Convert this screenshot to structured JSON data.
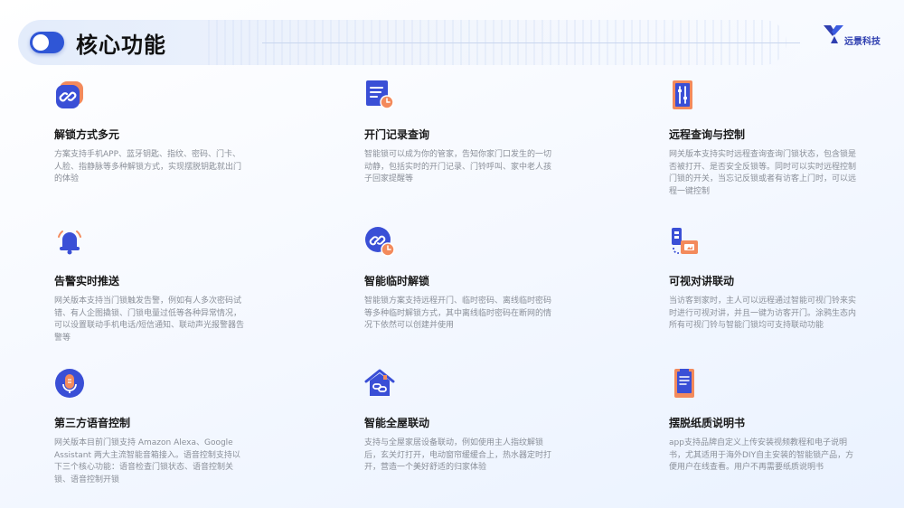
{
  "header": {
    "title": "核心功能",
    "logo_text": "远景科技"
  },
  "colors": {
    "accent": "#2f56d6",
    "icon_orange": "#f38a5c",
    "icon_blue": "#3a4fd6"
  },
  "features": [
    {
      "icon": "link-icon",
      "title": "解锁方式多元",
      "desc": "方案支持手机APP、蓝牙钥匙、指纹、密码、门卡、人脸、指静脉等多种解锁方式，实现摆脱钥匙就出门的体验"
    },
    {
      "icon": "document-clock-icon",
      "title": "开门记录查询",
      "desc": "智能锁可以成为你的管家，告知你家门口发生的一切动静，包括实时的开门记录、门铃呼叫、家中老人孩子回家提醒等"
    },
    {
      "icon": "sliders-icon",
      "title": "远程查询与控制",
      "desc": "网关版本支持实时远程查询查询门锁状态，包含锁是否被打开、是否安全反锁等。同时可以实时远程控制门锁的开关，当忘记反锁或者有访客上门时，可以远程一键控制"
    },
    {
      "icon": "bell-icon",
      "title": "告警实时推送",
      "desc": "网关版本支持当门锁触发告警，例如有人多次密码试错、有人企图撬锁、门锁电量过低等各种异常情况，可以设置联动手机电话/短信通知、联动声光报警器告警等"
    },
    {
      "icon": "link-clock-icon",
      "title": "智能临时解锁",
      "desc": "智能锁方案支持远程开门、临时密码、离线临时密码等多种临时解锁方式，其中离线临时密码在断网的情况下依然可以创建并使用"
    },
    {
      "icon": "video-intercom-icon",
      "title": "可视对讲联动",
      "desc": "当访客到家时，主人可以远程通过智能可视门铃来实时进行可视对讲，并且一键为访客开门。涂鸦生态内所有可视门铃与智能门锁均可支持联动功能"
    },
    {
      "icon": "microphone-icon",
      "title": "第三方语音控制",
      "desc": "网关版本目前门锁支持 Amazon Alexa、Google Assistant 两大主流智能音箱接入。语音控制支持以下三个核心功能：语音检查门锁状态、语音控制关锁、语音控制开锁"
    },
    {
      "icon": "house-link-icon",
      "title": "智能全屋联动",
      "desc": "支持与全屋家居设备联动，例如使用主人指纹解锁后，玄关灯打开，电动窗帘缓缓合上，热水器定时打开，营造一个美好舒适的归家体验"
    },
    {
      "icon": "manual-book-icon",
      "title": "摆脱纸质说明书",
      "desc": "app支持品牌自定义上传安装视频教程和电子说明书，尤其适用于海外DIY自主安装的智能锁产品，方便用户在线查看。用户不再需要纸质说明书"
    }
  ]
}
